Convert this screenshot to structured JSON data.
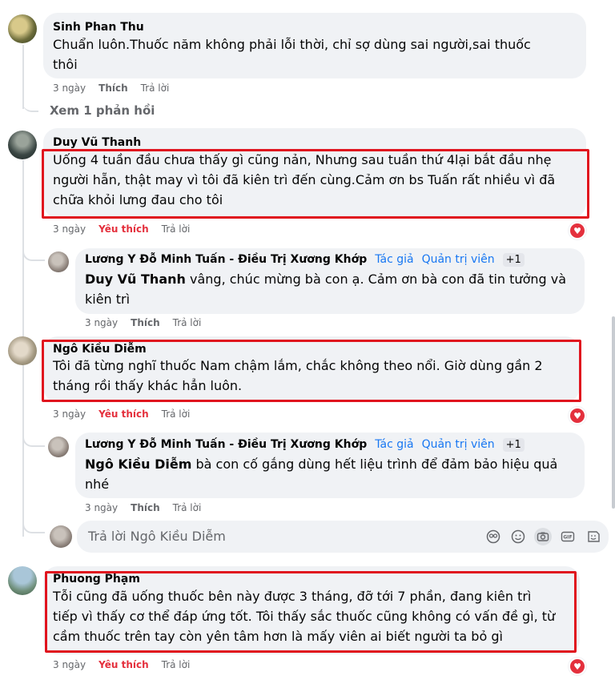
{
  "comments": [
    {
      "author": "Sinh Phan Thu",
      "text": "Chuẩn luôn.Thuốc năm không phải lỗi thời, chỉ sợ dùng sai người,sai thuốc\nthôi",
      "time": "3 ngày",
      "like": "Thích",
      "reply": "Trả lời",
      "see_replies": "Xem 1 phản hồi"
    },
    {
      "author": "Duy Vũ Thanh",
      "text": "Uống 4 tuần đầu chưa thấy gì cũng nản, Nhưng sau tuần thứ 4lại bắt đầu nhẹ\nngười hẵn, thật may vì tôi đã kiên trì đến cùng.Cảm ơn bs Tuấn rất nhiều vì đã\nchữa khỏi lưng đau cho tôi",
      "time": "3 ngày",
      "like": "Yêu thích",
      "reply": "Trả lời"
    },
    {
      "author": "Lương Y Đỗ Minh Tuấn - Điều Trị Xương Khớp",
      "badge_author": "Tác giả",
      "badge_admin": "Quản trị viên",
      "badge_plus": "+1",
      "mention": "Duy Vũ Thanh",
      "text": " vâng, chúc mừng bà con ạ. Cảm ơn bà con đã tin tưởng và\nkiên trì",
      "time": "3 ngày",
      "like": "Thích",
      "reply": "Trả lời"
    },
    {
      "author": "Ngô Kiều Diễm",
      "text": "Tôi đã từng nghĩ thuốc Nam chậm lắm, chắc không theo nổi. Giờ dùng gần 2\ntháng rồi thấy khác hẳn luôn.",
      "time": "3 ngày",
      "like": "Yêu thích",
      "reply": "Trả lời"
    },
    {
      "author": "Lương Y Đỗ Minh Tuấn - Điều Trị Xương Khớp",
      "badge_author": "Tác giả",
      "badge_admin": "Quản trị viên",
      "badge_plus": "+1",
      "mention": "Ngô Kiều Diễm",
      "text": " bà con cố gắng dùng hết liệu trình để đảm bảo hiệu quả\nnhé",
      "time": "3 ngày",
      "like": "Thích",
      "reply": "Trả lời"
    },
    {
      "author": "Phuong Phạm",
      "text": "Tỗi cũng đã uống thuốc bên này được 3 tháng, đỡ tới 7 phần, đang kiên trì\ntiếp vì thấy cơ thể đáp ứng tốt. Tôi thấy sắc thuốc cũng không có vấn đề gì, từ\ncầm thuốc trên tay còn yên tâm hơn là mấy viên ai biết người ta bỏ gì",
      "time": "3 ngày",
      "like": "Yêu thích",
      "reply": "Trả lời"
    }
  ],
  "reply_input": {
    "placeholder": "Trả lời Ngô Kiều Diễm"
  },
  "reaction": "heart",
  "colors": {
    "highlight_box": "#e0141e",
    "bubble": "#f0f2f5",
    "love": "#e4303d",
    "badge": "#1877f2"
  }
}
